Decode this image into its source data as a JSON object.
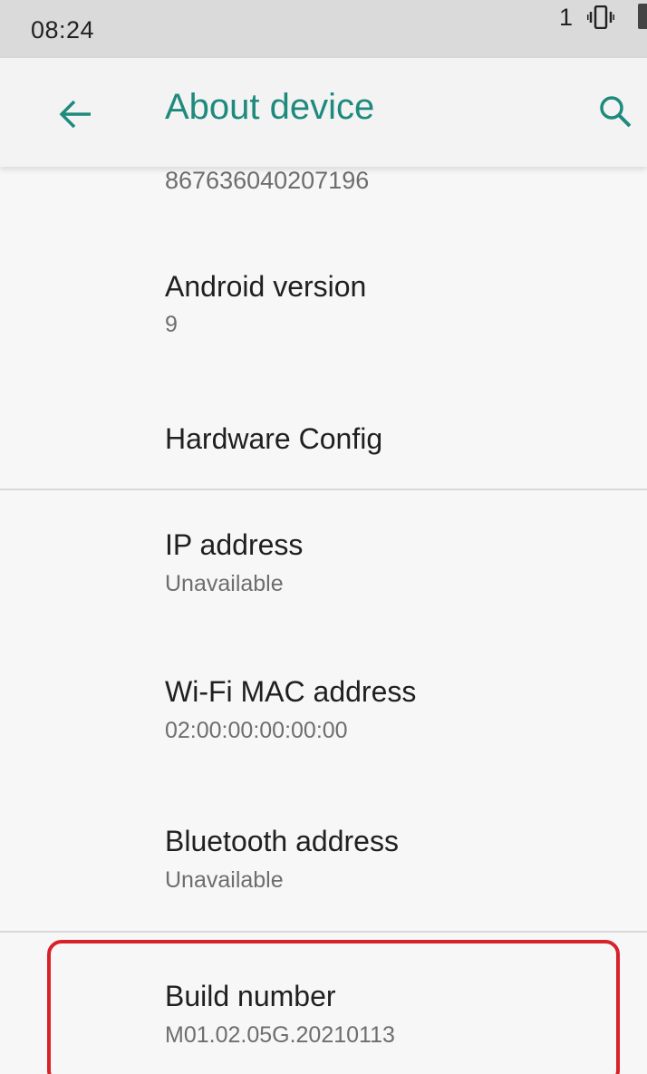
{
  "status_bar": {
    "time": "08:24",
    "notification_count": "1",
    "icons": [
      "vibrate-icon",
      "battery-icon"
    ]
  },
  "app_bar": {
    "title": "About device",
    "back_icon": "arrow-back-icon",
    "search_icon": "search-icon",
    "title_color": "#1e8a7d"
  },
  "list": {
    "imei_summary": "867636040207196",
    "android_version": {
      "title": "Android version",
      "summary": "9"
    },
    "hardware_config": {
      "title": "Hardware Config"
    },
    "ip_address": {
      "title": "IP address",
      "summary": "Unavailable"
    },
    "wifi_mac": {
      "title": "Wi-Fi MAC address",
      "summary": "02:00:00:00:00:00"
    },
    "bluetooth": {
      "title": "Bluetooth address",
      "summary": "Unavailable"
    },
    "build_number": {
      "title": "Build number",
      "summary": "M01.02.05G.20210113"
    }
  },
  "highlight_color": "#d8222a"
}
